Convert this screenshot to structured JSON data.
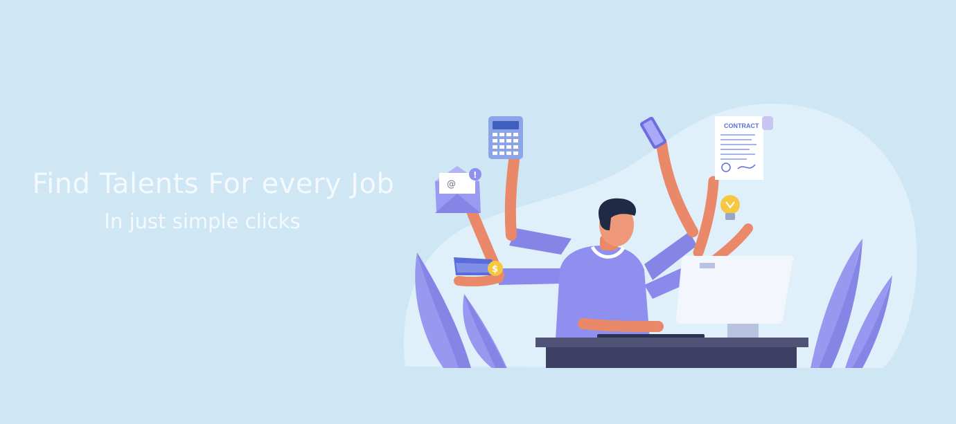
{
  "hero": {
    "headline": "Find Talents For every Job",
    "subline": "In just simple clicks"
  },
  "illustration": {
    "contract_label": "CONTRACT",
    "coin_symbol": "$",
    "mail_symbol": "@",
    "alert_symbol": "!"
  },
  "colors": {
    "background": "#cfe7f5",
    "blob": "#dff0fa",
    "accent_purple": "#8f8ff0",
    "plant_purple": "#9898f0",
    "desk": "#505276",
    "skin": "#e9896a"
  }
}
